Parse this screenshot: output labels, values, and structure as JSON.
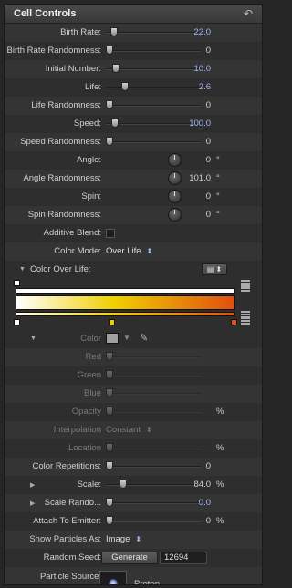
{
  "header": {
    "title": "Cell Controls",
    "undo_icon": "undo-arrow-icon"
  },
  "rows_top": [
    {
      "label": "Birth Rate:",
      "value": "22.0",
      "blue": true,
      "thumb_frac": 0.05
    },
    {
      "label": "Birth Rate Randomness:",
      "value": "0",
      "thumb_frac": 0.0
    },
    {
      "label": "Initial Number:",
      "value": "10.0",
      "blue": true,
      "thumb_frac": 0.07
    },
    {
      "label": "Life:",
      "value": "2.6",
      "blue": true,
      "thumb_frac": 0.18
    },
    {
      "label": "Life Randomness:",
      "value": "0",
      "thumb_frac": 0.0
    },
    {
      "label": "Speed:",
      "value": "100.0",
      "blue": true,
      "thumb_frac": 0.06
    },
    {
      "label": "Speed Randomness:",
      "value": "0",
      "thumb_frac": 0.0
    }
  ],
  "dials": [
    {
      "label": "Angle:",
      "value": "0",
      "unit": "°"
    },
    {
      "label": "Angle Randomness:",
      "value": "101.0",
      "unit": "°"
    },
    {
      "label": "Spin:",
      "value": "0",
      "unit": "°"
    },
    {
      "label": "Spin Randomness:",
      "value": "0",
      "unit": "°"
    }
  ],
  "additive_blend": {
    "label": "Additive Blend:",
    "checked": false
  },
  "color_mode": {
    "label": "Color Mode:",
    "value": "Over Life"
  },
  "color_over_life": {
    "label": "Color Over Life:",
    "preset_icon": "gradient-preset-icon"
  },
  "gradient": {
    "opacity_stops_colors": [
      "#ffffff"
    ],
    "color_stops": [
      "#ffffff",
      "#f0d000",
      "#e05010"
    ]
  },
  "color_section": {
    "label": "Color",
    "swatch": "#a0a0a0",
    "eyedropper_icon": "eyedropper-icon",
    "channels": [
      "Red",
      "Green",
      "Blue",
      "Opacity"
    ],
    "opacity_unit": "%",
    "interpolation": {
      "label": "Interpolation",
      "value": "Constant"
    },
    "location": {
      "label": "Location",
      "unit": "%"
    }
  },
  "rows_bottom": [
    {
      "label": "Color Repetitions:",
      "value": "0",
      "thumb_frac": 0.0
    },
    {
      "label": "Scale:",
      "value": "84.0",
      "unit": "%",
      "thumb_frac": 0.16,
      "expand": true
    },
    {
      "label": "Scale Rando...",
      "value": "0.0",
      "blue": true,
      "thumb_frac": 0.0,
      "expand": true
    },
    {
      "label": "Attach To Emitter:",
      "value": "0",
      "unit": "%",
      "thumb_frac": 0.0
    }
  ],
  "show_particles": {
    "label": "Show Particles As:",
    "value": "Image"
  },
  "random_seed": {
    "label": "Random Seed:",
    "button": "Generate",
    "value": "12694"
  },
  "particle_source": {
    "label": "Particle Source:",
    "value": "Proton"
  }
}
